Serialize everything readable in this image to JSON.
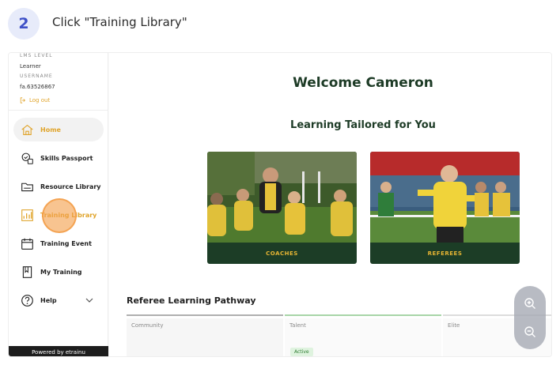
{
  "step": {
    "number": "2",
    "instruction": "Click \"Training Library\""
  },
  "sidebar": {
    "lms_level_label": "LMS LEVEL",
    "lms_level_value": "Learner",
    "username_label": "USERNAME",
    "username_value": "fa.63526867",
    "logout_label": "Log out",
    "items": [
      {
        "label": "Home",
        "icon": "home-icon",
        "active": true
      },
      {
        "label": "Skills Passport",
        "icon": "passport-icon"
      },
      {
        "label": "Resource Library",
        "icon": "folder-icon"
      },
      {
        "label": "Training Library",
        "icon": "chart-icon",
        "highlighted": true
      },
      {
        "label": "Training Event",
        "icon": "calendar-icon"
      },
      {
        "label": "My Training",
        "icon": "book-icon"
      },
      {
        "label": "Help",
        "icon": "help-icon",
        "has_chevron": true
      }
    ],
    "powered_by": "Powered by etrainu"
  },
  "main": {
    "welcome": "Welcome Cameron",
    "subtitle": "Learning Tailored for You",
    "cards": [
      {
        "label": "COACHES"
      },
      {
        "label": "REFEREES"
      }
    ],
    "pathway": {
      "title": "Referee Learning Pathway",
      "columns": [
        {
          "label": "Community"
        },
        {
          "label": "Talent"
        },
        {
          "label": "Elite"
        }
      ],
      "status_badge": "Active"
    }
  },
  "colors": {
    "accent": "#e0a42b",
    "brand_dark": "#1d3b26",
    "step_badge_bg": "#e7ebfa",
    "step_badge_text": "#3f51c7",
    "track_gray": "#b0b0b0",
    "track_green": "#a8d5a8"
  },
  "zoom": {
    "in_icon": "zoom-in-icon",
    "out_icon": "zoom-out-icon"
  }
}
